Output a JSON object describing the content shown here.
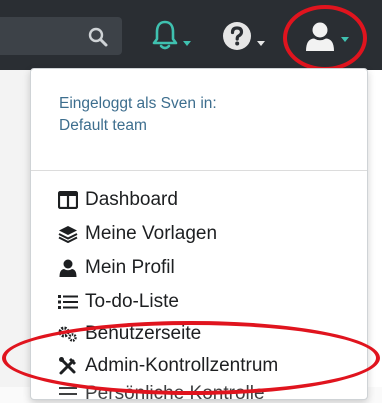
{
  "topbar": {
    "icons": [
      "search-icon",
      "bell-icon",
      "help-icon",
      "user-icon"
    ],
    "colors": {
      "background": "#2a2e33",
      "bell": "#3fc1b0",
      "highlight": "#e0141e"
    }
  },
  "dropdown": {
    "header_line1": "Eingeloggt als Sven in:",
    "header_line2": "Default team",
    "items": [
      {
        "label": "Dashboard",
        "icon": "columns-icon"
      },
      {
        "label": "Meine Vorlagen",
        "icon": "layers-icon"
      },
      {
        "label": "Mein Profil",
        "icon": "user-icon"
      },
      {
        "label": "To-do-Liste",
        "icon": "list-icon"
      },
      {
        "label": "Benutzerseite",
        "icon": "cogs-icon"
      },
      {
        "label": "Admin-Kontrollzentrum",
        "icon": "tools-icon"
      },
      {
        "label": "Persönliche Kontrolle",
        "icon": "sliders-icon"
      }
    ]
  }
}
